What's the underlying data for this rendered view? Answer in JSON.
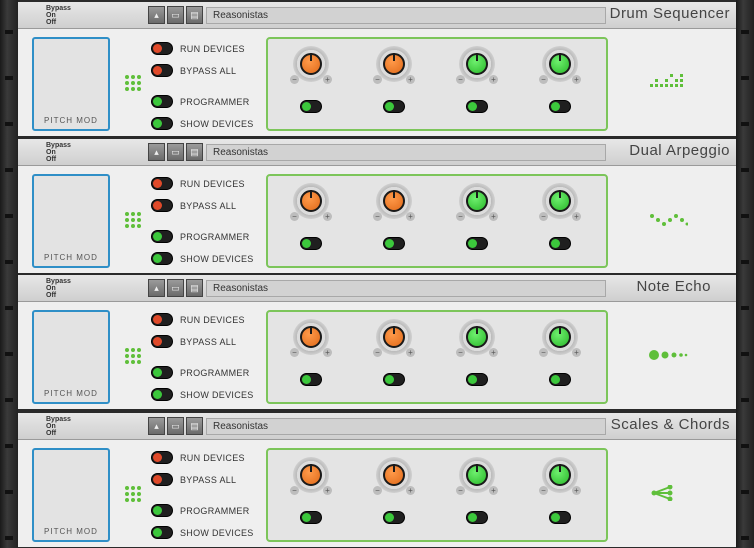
{
  "bypass": {
    "line1": "Bypass",
    "line2": "On",
    "line3": "Off"
  },
  "patch_name": "Reasonistas",
  "pitch_mod": "PITCH  MOD",
  "switches": {
    "run": "RUN DEVICES",
    "bypass_all": "BYPASS ALL",
    "programmer": "PROGRAMMER",
    "show": "SHOW DEVICES"
  },
  "devices": [
    {
      "title": "Drum Sequencer",
      "icon": "drum-sequencer-icon"
    },
    {
      "title": "Dual Arpeggio",
      "icon": "arpeggio-icon"
    },
    {
      "title": "Note Echo",
      "icon": "note-echo-icon"
    },
    {
      "title": "Scales & Chords",
      "icon": "scales-chords-icon"
    }
  ],
  "colors": {
    "accent_green": "#5fbf3a",
    "accent_blue": "#2f8fc7",
    "knob_orange": "#e06a1a",
    "knob_green": "#29b829",
    "toggle_red": "#e04a2a"
  }
}
